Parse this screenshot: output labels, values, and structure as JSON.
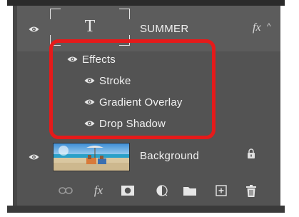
{
  "layers": [
    {
      "name": "SUMMER",
      "kind": "type",
      "thumbnail_glyph": "T",
      "fx_label": "fx",
      "effects_header": "Effects",
      "effects": [
        "Stroke",
        "Gradient Overlay",
        "Drop Shadow"
      ]
    },
    {
      "name": "Background",
      "kind": "image",
      "locked": true
    }
  ],
  "toolbar_icons": [
    "link-layers-icon",
    "add-layer-style-icon",
    "add-mask-icon",
    "adjustment-layer-icon",
    "new-group-icon",
    "new-layer-icon",
    "delete-icon"
  ],
  "toolbar_fx_label": "fx",
  "colors": {
    "panel_bg": "#535353",
    "selected_row_bg": "#5c5c5c",
    "highlight_box": "#e51a1a",
    "text": "#f0f0f0"
  }
}
